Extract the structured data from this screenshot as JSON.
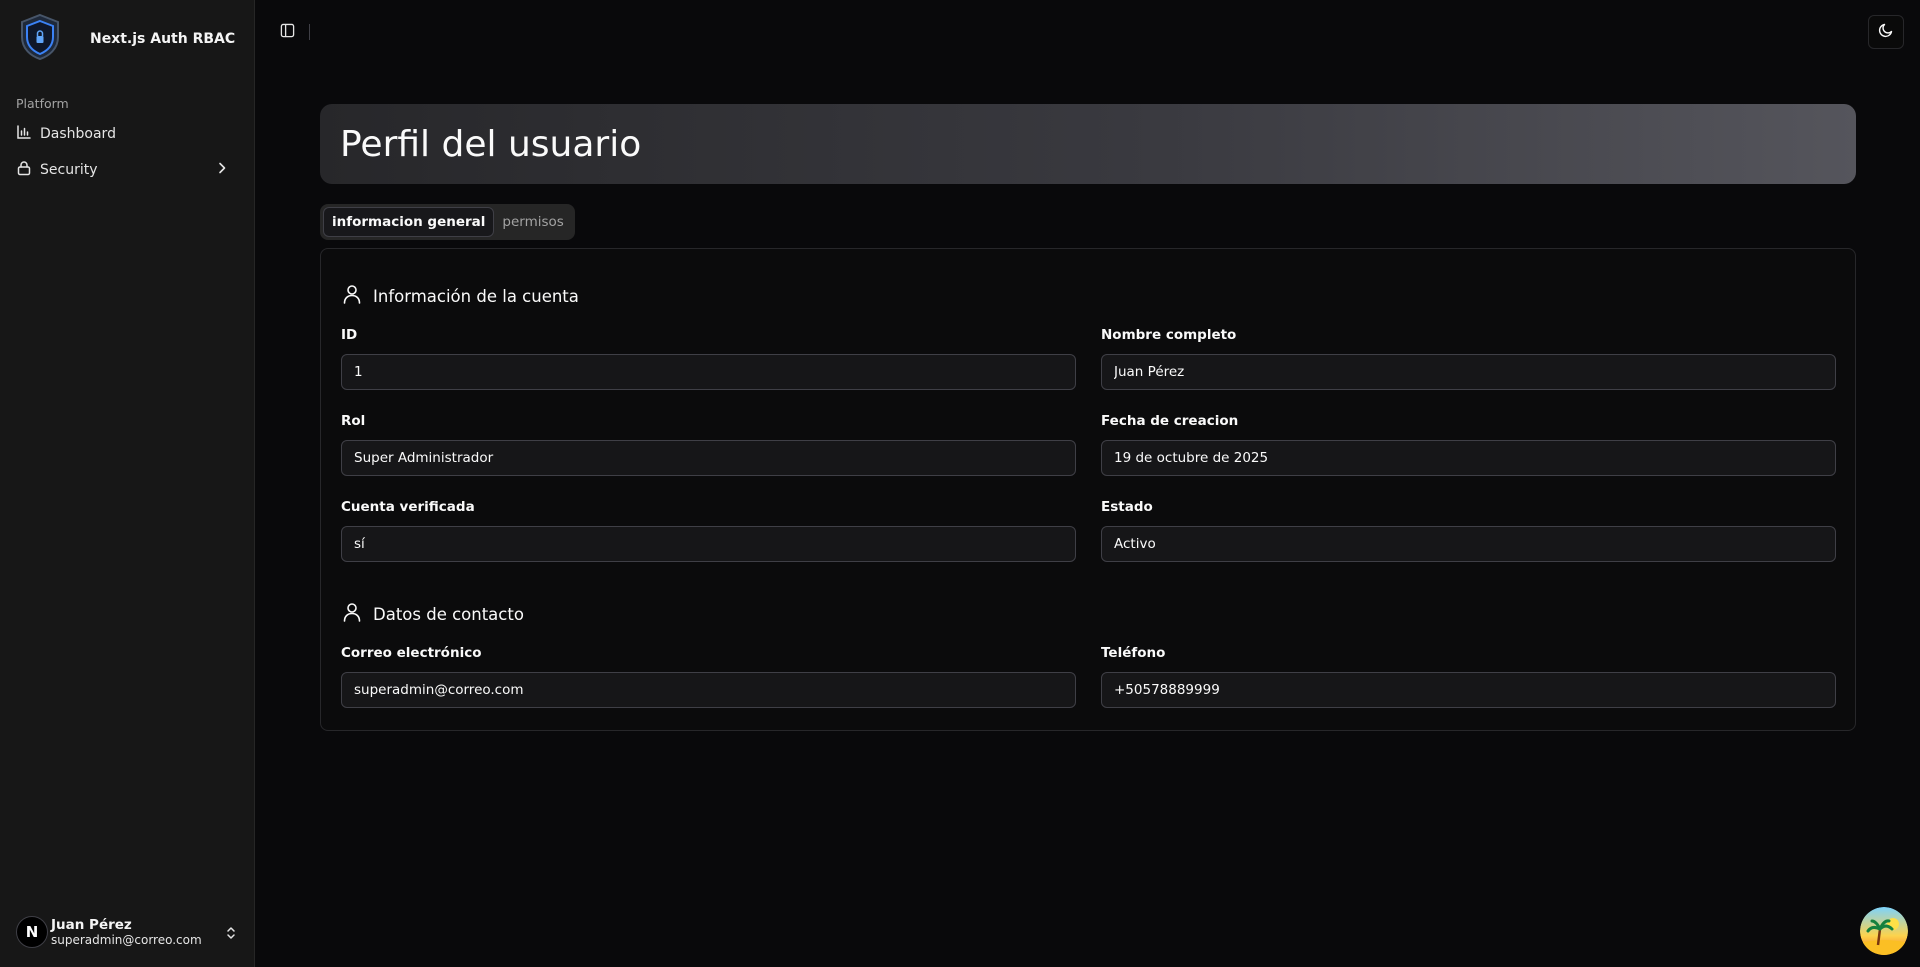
{
  "app": {
    "name": "Next.js Auth RBAC"
  },
  "sidebar": {
    "group_label": "Platform",
    "items": [
      {
        "label": "Dashboard",
        "icon": "bar-chart-icon"
      },
      {
        "label": "Security",
        "icon": "lock-icon"
      }
    ],
    "user": {
      "initial": "N",
      "name": "Juan Pérez",
      "email": "superadmin@correo.com"
    }
  },
  "page": {
    "title": "Perfil del usuario"
  },
  "tabs": [
    {
      "label": "informacion general",
      "active": true
    },
    {
      "label": "permisos",
      "active": false
    }
  ],
  "account_section": {
    "title": "Información de la cuenta",
    "fields": {
      "id": {
        "label": "ID",
        "value": "1"
      },
      "full_name": {
        "label": "Nombre completo",
        "value": "Juan Pérez"
      },
      "role": {
        "label": "Rol",
        "value": "Super Administrador"
      },
      "created": {
        "label": "Fecha de creacion",
        "value": "19 de octubre de 2025"
      },
      "verified": {
        "label": "Cuenta verificada",
        "value": "sí"
      },
      "status": {
        "label": "Estado",
        "value": "Activo"
      }
    }
  },
  "contact_section": {
    "title": "Datos de contacto",
    "fields": {
      "email": {
        "label": "Correo electrónico",
        "value": "superadmin@correo.com"
      },
      "phone": {
        "label": "Teléfono",
        "value": "+50578889999"
      }
    }
  },
  "colors": {
    "background": "#09090b",
    "sidebar": "#171717",
    "accent_logo": "#3b82f6"
  }
}
